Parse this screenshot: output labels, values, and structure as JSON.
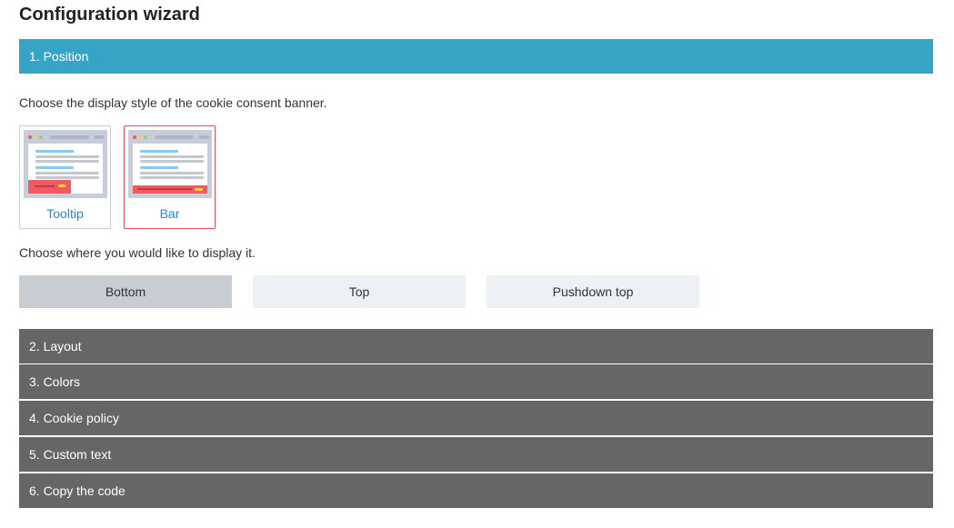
{
  "title": "Configuration wizard",
  "sections": [
    {
      "label": "1. Position"
    },
    {
      "label": "2. Layout"
    },
    {
      "label": "3. Colors"
    },
    {
      "label": "4. Cookie policy"
    },
    {
      "label": "5. Custom text"
    },
    {
      "label": "6. Copy the code"
    }
  ],
  "position": {
    "style_prompt": "Choose the display style of the cookie consent banner.",
    "styles": [
      {
        "label": "Tooltip",
        "selected": false
      },
      {
        "label": "Bar",
        "selected": true
      }
    ],
    "placement_prompt": "Choose where you would like to display it.",
    "placements": [
      {
        "label": "Bottom",
        "selected": true
      },
      {
        "label": "Top",
        "selected": false
      },
      {
        "label": "Pushdown top",
        "selected": false
      }
    ]
  },
  "colors": {
    "active_header": "#36a5c5",
    "collapsed_header": "#666666",
    "selected_border": "#e0505a",
    "link": "#2b83d3",
    "banner_red": "#f05a60"
  }
}
